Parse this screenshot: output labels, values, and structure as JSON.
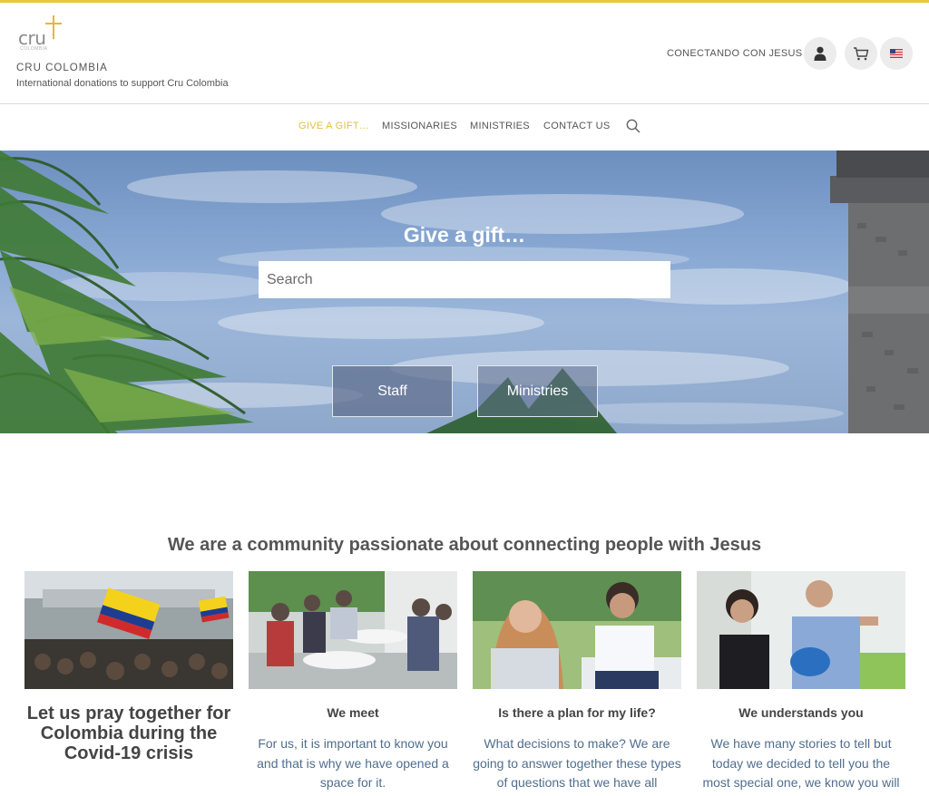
{
  "header": {
    "logo_word": "cru",
    "logo_sub": "COLOMBIA",
    "site_name": "CRU COLOMBIA",
    "tagline": "International donations to support Cru Colombia",
    "conectando": "CONECTANDO CON JESUS",
    "icons": [
      "user-icon",
      "cart-icon",
      "us-flag-icon"
    ]
  },
  "nav": {
    "items": [
      "GIVE A GIFT…",
      "MISSIONARIES",
      "MINISTRIES",
      "CONTACT US"
    ],
    "active": "GIVE A GIFT…",
    "search_icon": "search-icon"
  },
  "hero": {
    "title": "Give a gift…",
    "search_placeholder": "Search",
    "buttons": [
      "Staff",
      "Ministries"
    ]
  },
  "community": {
    "title": "We are a community passionate about connecting people with Jesus",
    "cards": [
      {
        "title": "Let us pray together for Colombia during the Covid-19 crisis",
        "text": ""
      },
      {
        "title": "We meet",
        "text": "For us, it is important to know you and that is why we have opened a space for it."
      },
      {
        "title": "Is there a plan for my life?",
        "text": "What decisions to make? We are going to answer together these types of questions that we have all"
      },
      {
        "title": "We understands you",
        "text": "We have many stories to tell but today we decided to tell you the most special one, we know you will"
      }
    ]
  },
  "colors": {
    "accent": "#e9c93a",
    "nav_active": "#e0c23e",
    "card_text": "#4f6e8e"
  }
}
